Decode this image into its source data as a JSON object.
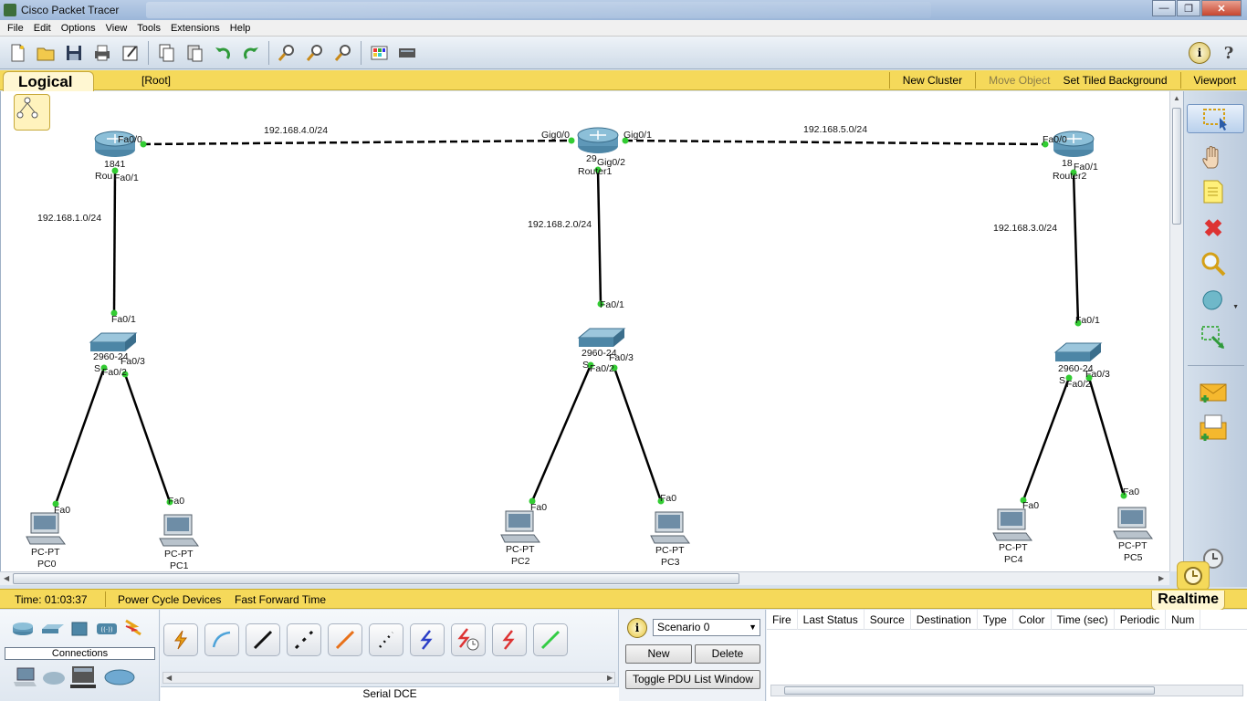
{
  "window": {
    "title": "Cisco Packet Tracer"
  },
  "menu": [
    "File",
    "Edit",
    "Options",
    "View",
    "Tools",
    "Extensions",
    "Help"
  ],
  "workspace_bar": {
    "tab": "Logical",
    "root": "[Root]",
    "new_cluster": "New Cluster",
    "move_object": "Move Object",
    "set_tiled_background": "Set Tiled Background",
    "viewport": "Viewport"
  },
  "topology": {
    "networks": [
      "192.168.4.0/24",
      "192.168.5.0/24",
      "192.168.1.0/24",
      "192.168.2.0/24",
      "192.168.3.0/24"
    ],
    "routers": [
      {
        "model": "1841",
        "name": "Rou",
        "ports": [
          "Fa0/0",
          "Fa0/1"
        ]
      },
      {
        "model": "29",
        "name": "Router1",
        "ports": [
          "Gig0/0",
          "Gig0/1",
          "Gig0/2"
        ]
      },
      {
        "model": "18",
        "name": "Router2",
        "ports": [
          "Fa0/0",
          "Fa0/1"
        ]
      }
    ],
    "switches": [
      {
        "model": "2960-24",
        "name": "S",
        "ports": [
          "Fa0/1",
          "Fa0/2",
          "Fa0/3"
        ]
      },
      {
        "model": "2960-24",
        "name": "S",
        "ports": [
          "Fa0/1",
          "Fa0/2",
          "Fa0/3"
        ]
      },
      {
        "model": "2960-24",
        "name": "S",
        "ports": [
          "Fa0/1",
          "Fa0/2",
          "Fa0/3"
        ]
      }
    ],
    "pcs": [
      {
        "type": "PC-PT",
        "name": "PC0",
        "port": "Fa0"
      },
      {
        "type": "PC-PT",
        "name": "PC1",
        "port": "Fa0"
      },
      {
        "type": "PC-PT",
        "name": "PC2",
        "port": "Fa0"
      },
      {
        "type": "PC-PT",
        "name": "PC3",
        "port": "Fa0"
      },
      {
        "type": "PC-PT",
        "name": "PC4",
        "port": "Fa0"
      },
      {
        "type": "PC-PT",
        "name": "PC5",
        "port": "Fa0"
      }
    ]
  },
  "timebar": {
    "time": "Time: 01:03:37",
    "power_cycle": "Power Cycle Devices",
    "fast_forward": "Fast Forward Time",
    "mode": "Realtime"
  },
  "bottom": {
    "connections_label": "Connections",
    "selected_connection": "Serial DCE",
    "scenario": "Scenario 0",
    "new_label": "New",
    "delete_label": "Delete",
    "toggle_pdu": "Toggle PDU List Window",
    "pdu_columns": [
      "Fire",
      "Last Status",
      "Source",
      "Destination",
      "Type",
      "Color",
      "Time (sec)",
      "Periodic",
      "Num"
    ]
  },
  "colors": {
    "accent_yellow": "#f5d95a",
    "link_green": "#33cc33"
  }
}
